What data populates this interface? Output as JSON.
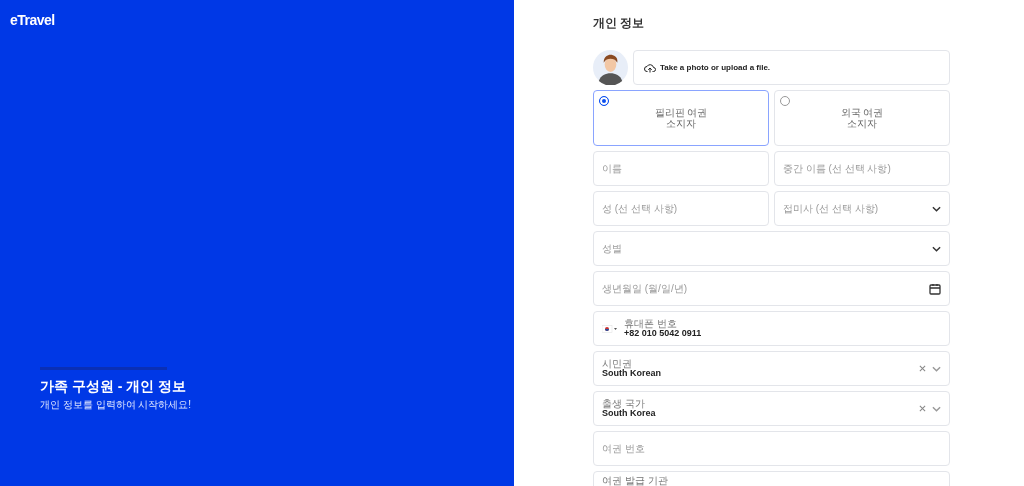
{
  "logo": "eTravel",
  "hero": {
    "title": "가족 구성원 - 개인 정보",
    "subtitle": "개인 정보를 입력하여 시작하세요!"
  },
  "form": {
    "title": "개인 정보",
    "photo_upload": {
      "label": "Take a photo or upload a file."
    },
    "passport_options": [
      {
        "label_lines": [
          "필리핀 여권",
          "소지자"
        ],
        "selected": true
      },
      {
        "label_lines": [
          "외국 여권",
          "소지자"
        ],
        "selected": false
      }
    ],
    "rows": [
      [
        {
          "kind": "text",
          "placeholder": "이름"
        },
        {
          "kind": "text",
          "placeholder": "중간 이름 (선 선택 사항)"
        }
      ],
      [
        {
          "kind": "text",
          "placeholder": "성 (선 선택 사항)"
        },
        {
          "kind": "select",
          "placeholder": "접미사 (선 선택 사항)"
        }
      ],
      [
        {
          "kind": "select",
          "placeholder": "성별"
        }
      ],
      [
        {
          "kind": "date",
          "placeholder": "생년월일 (월/일/년)"
        }
      ],
      [
        {
          "kind": "phone",
          "label": "휴대폰 번호",
          "value": "+82 010 5042 0911"
        }
      ],
      [
        {
          "kind": "combo",
          "label": "시민권",
          "value": "South Korean"
        }
      ],
      [
        {
          "kind": "combo",
          "label": "출생 국가",
          "value": "South Korea"
        }
      ],
      [
        {
          "kind": "text",
          "placeholder": "여권 번호"
        }
      ],
      [
        {
          "kind": "labelonly",
          "label": "여권 발급 기관"
        }
      ]
    ]
  }
}
